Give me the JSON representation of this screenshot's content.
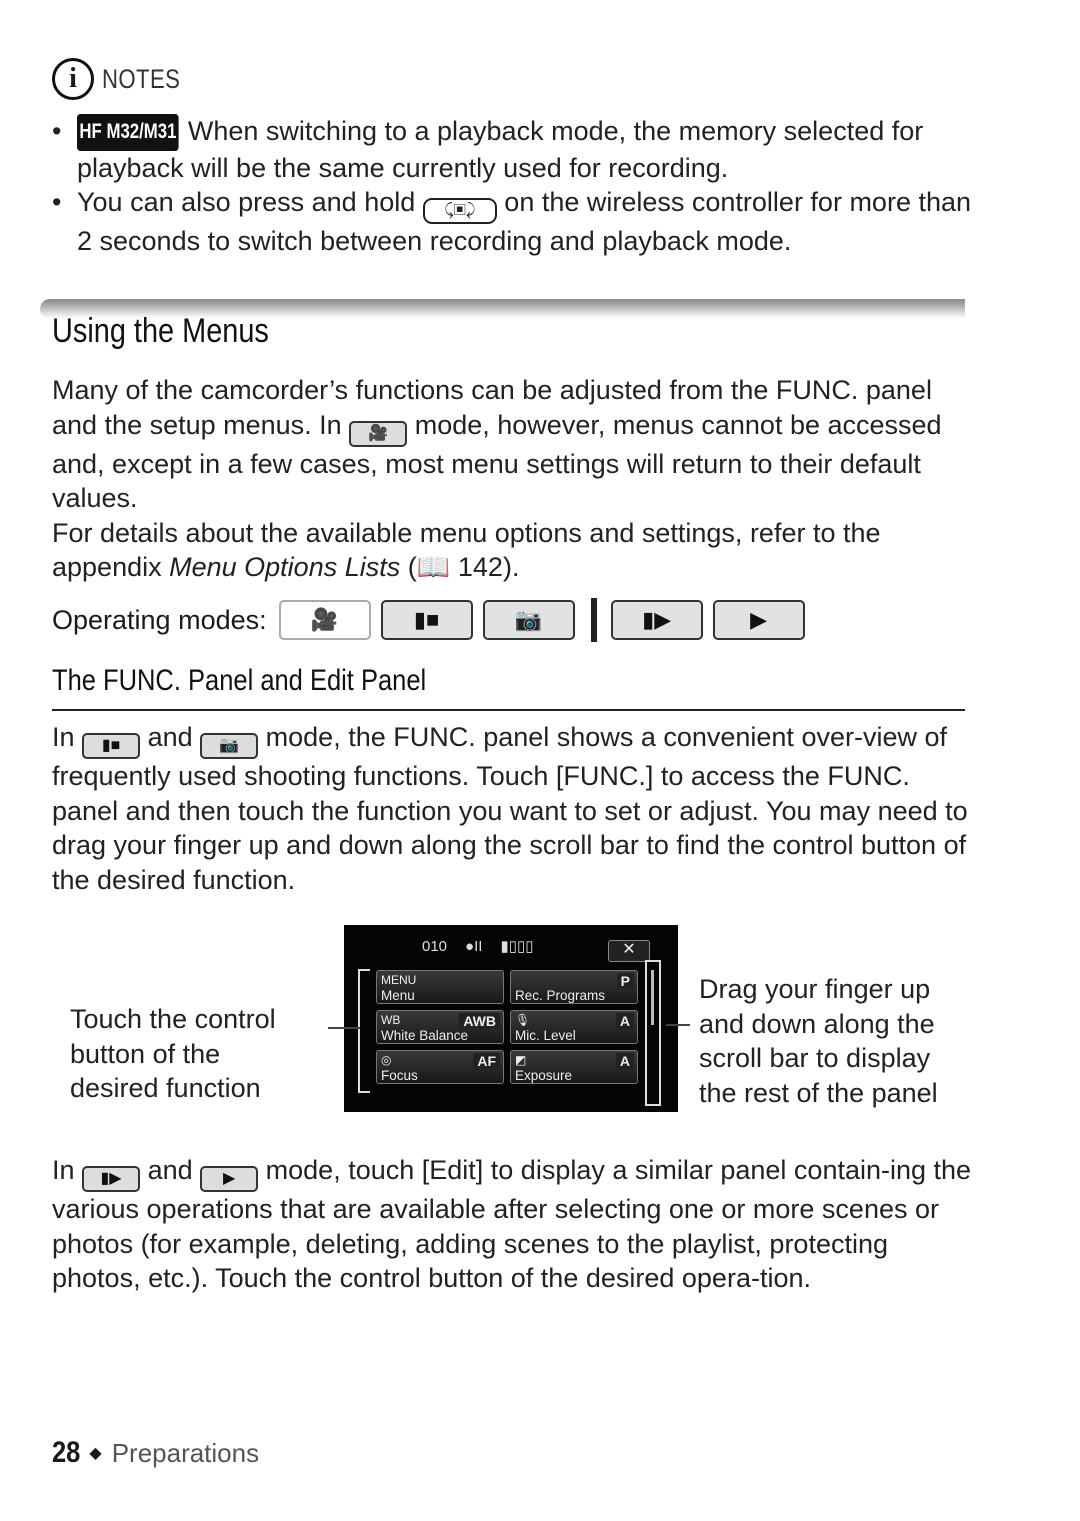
{
  "notes": {
    "label": "NOTES",
    "icon": "info-icon",
    "items": [
      {
        "badge": "HF M32/M31",
        "text": "When switching to a playback mode, the memory selected for playback will be the same currently used for recording."
      },
      {
        "text_before": "You can also press and hold",
        "key": "record-playback-key",
        "key_glyph": "⤹▣⤸",
        "text_after": "on the wireless controller for more than 2 seconds to switch between recording and playback mode."
      }
    ]
  },
  "section": {
    "title": "Using the Menus",
    "intro_p1_a": "Many of the camcorder’s functions can be adjusted from the FUNC. panel and the setup menus. In",
    "intro_p1_icon": "smart-auto-mode-icon",
    "intro_p1_b": "mode, however, menus cannot be accessed and, except in a few cases, most menu settings will return to their default values.",
    "intro_p2_a": "For details about the available menu options and settings, refer to the appendix",
    "intro_p2_ref": "Menu Options Lists",
    "intro_p2_b": "(",
    "intro_p2_page": "142",
    "intro_p2_c": ").",
    "operating_modes_label": "Operating modes:",
    "modes": [
      {
        "name": "smart-auto",
        "glyph": "🎥",
        "enabled": false
      },
      {
        "name": "movie-record",
        "glyph": "▮■",
        "enabled": true
      },
      {
        "name": "photo-record",
        "glyph": "📷",
        "enabled": true
      },
      {
        "name": "movie-playback",
        "glyph": "▮▶",
        "enabled": true
      },
      {
        "name": "photo-playback",
        "glyph": "▶",
        "enabled": true
      }
    ]
  },
  "subsection": {
    "title": "The FUNC. Panel and Edit Panel",
    "p1_a": "In",
    "p1_and": "and",
    "p1_b": "mode, the FUNC. panel shows a convenient over-view of frequently used shooting functions. Touch [FUNC.] to access the FUNC. panel and then touch the function you want to set or adjust. You may need to drag your finger up and down along the scroll bar to find the control button of the desired function.",
    "p2_a": "In",
    "p2_and": "and",
    "p2_b": "mode, touch [Edit] to display a similar panel contain-ing the various operations that are available after selecting one or more scenes or photos (for example, deleting, adding scenes to the playlist, protecting photos, etc.). Touch the control button of the desired opera-tion."
  },
  "screen": {
    "status": {
      "counter": "010",
      "rec": "●II",
      "battery": "▮▯▯▯"
    },
    "close": "✕",
    "buttons": [
      {
        "top": "MENU",
        "name": "Menu",
        "value": ""
      },
      {
        "top": "",
        "name": "Rec. Programs",
        "value": "P"
      },
      {
        "top": "WB",
        "name": "White Balance",
        "value": "AWB"
      },
      {
        "top": "🎙",
        "name": "Mic. Level",
        "value": "A"
      },
      {
        "top": "◎",
        "name": "Focus",
        "value": "AF"
      },
      {
        "top": "◩",
        "name": "Exposure",
        "value": "A"
      }
    ]
  },
  "callouts": {
    "left": "Touch the control button of the desired function",
    "right": "Drag your finger up and down along the scroll bar to display the rest of the panel"
  },
  "footer": {
    "page": "28",
    "separator": "◆",
    "section": "Preparations"
  }
}
